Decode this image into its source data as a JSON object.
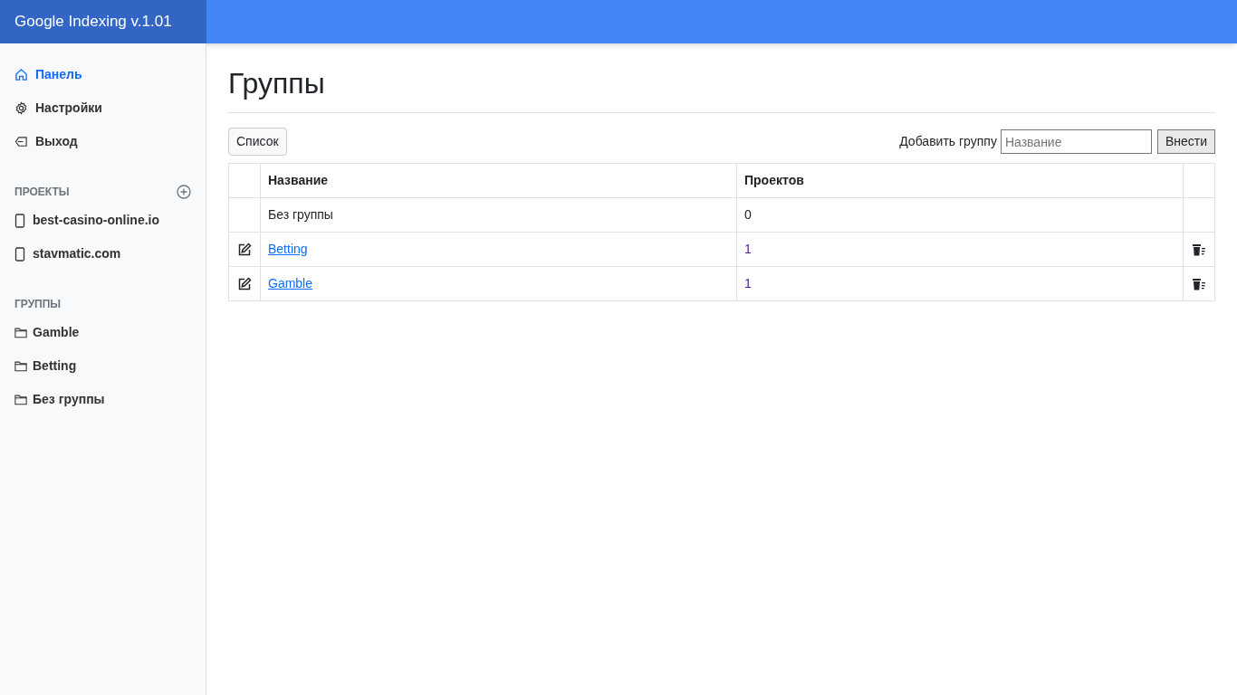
{
  "brand": "Google Indexing v.1.01",
  "nav": [
    {
      "label": "Панель",
      "kind": "home",
      "selected": true
    },
    {
      "label": "Настройки",
      "kind": "settings",
      "selected": false
    },
    {
      "label": "Выход",
      "kind": "logout",
      "selected": false
    }
  ],
  "projects": {
    "heading": "ПРОЕКТЫ",
    "items": [
      "best-casino-online.io",
      "stavmatic.com"
    ]
  },
  "groups": {
    "heading": "ГРУППЫ",
    "items": [
      "Gamble",
      "Betting",
      "Без группы"
    ]
  },
  "page_title": "Группы",
  "list_button": "Список",
  "add_group": {
    "label": "Добавить группу",
    "placeholder": "Название",
    "button": "Внести"
  },
  "table": {
    "columns": [
      "Название",
      "Проектов"
    ],
    "rows": [
      {
        "kind": "plain",
        "name": "Без группы",
        "count": "0"
      },
      {
        "kind": "group",
        "name": "Betting",
        "count": "1"
      },
      {
        "kind": "group",
        "name": "Gamble",
        "count": "1"
      }
    ]
  }
}
